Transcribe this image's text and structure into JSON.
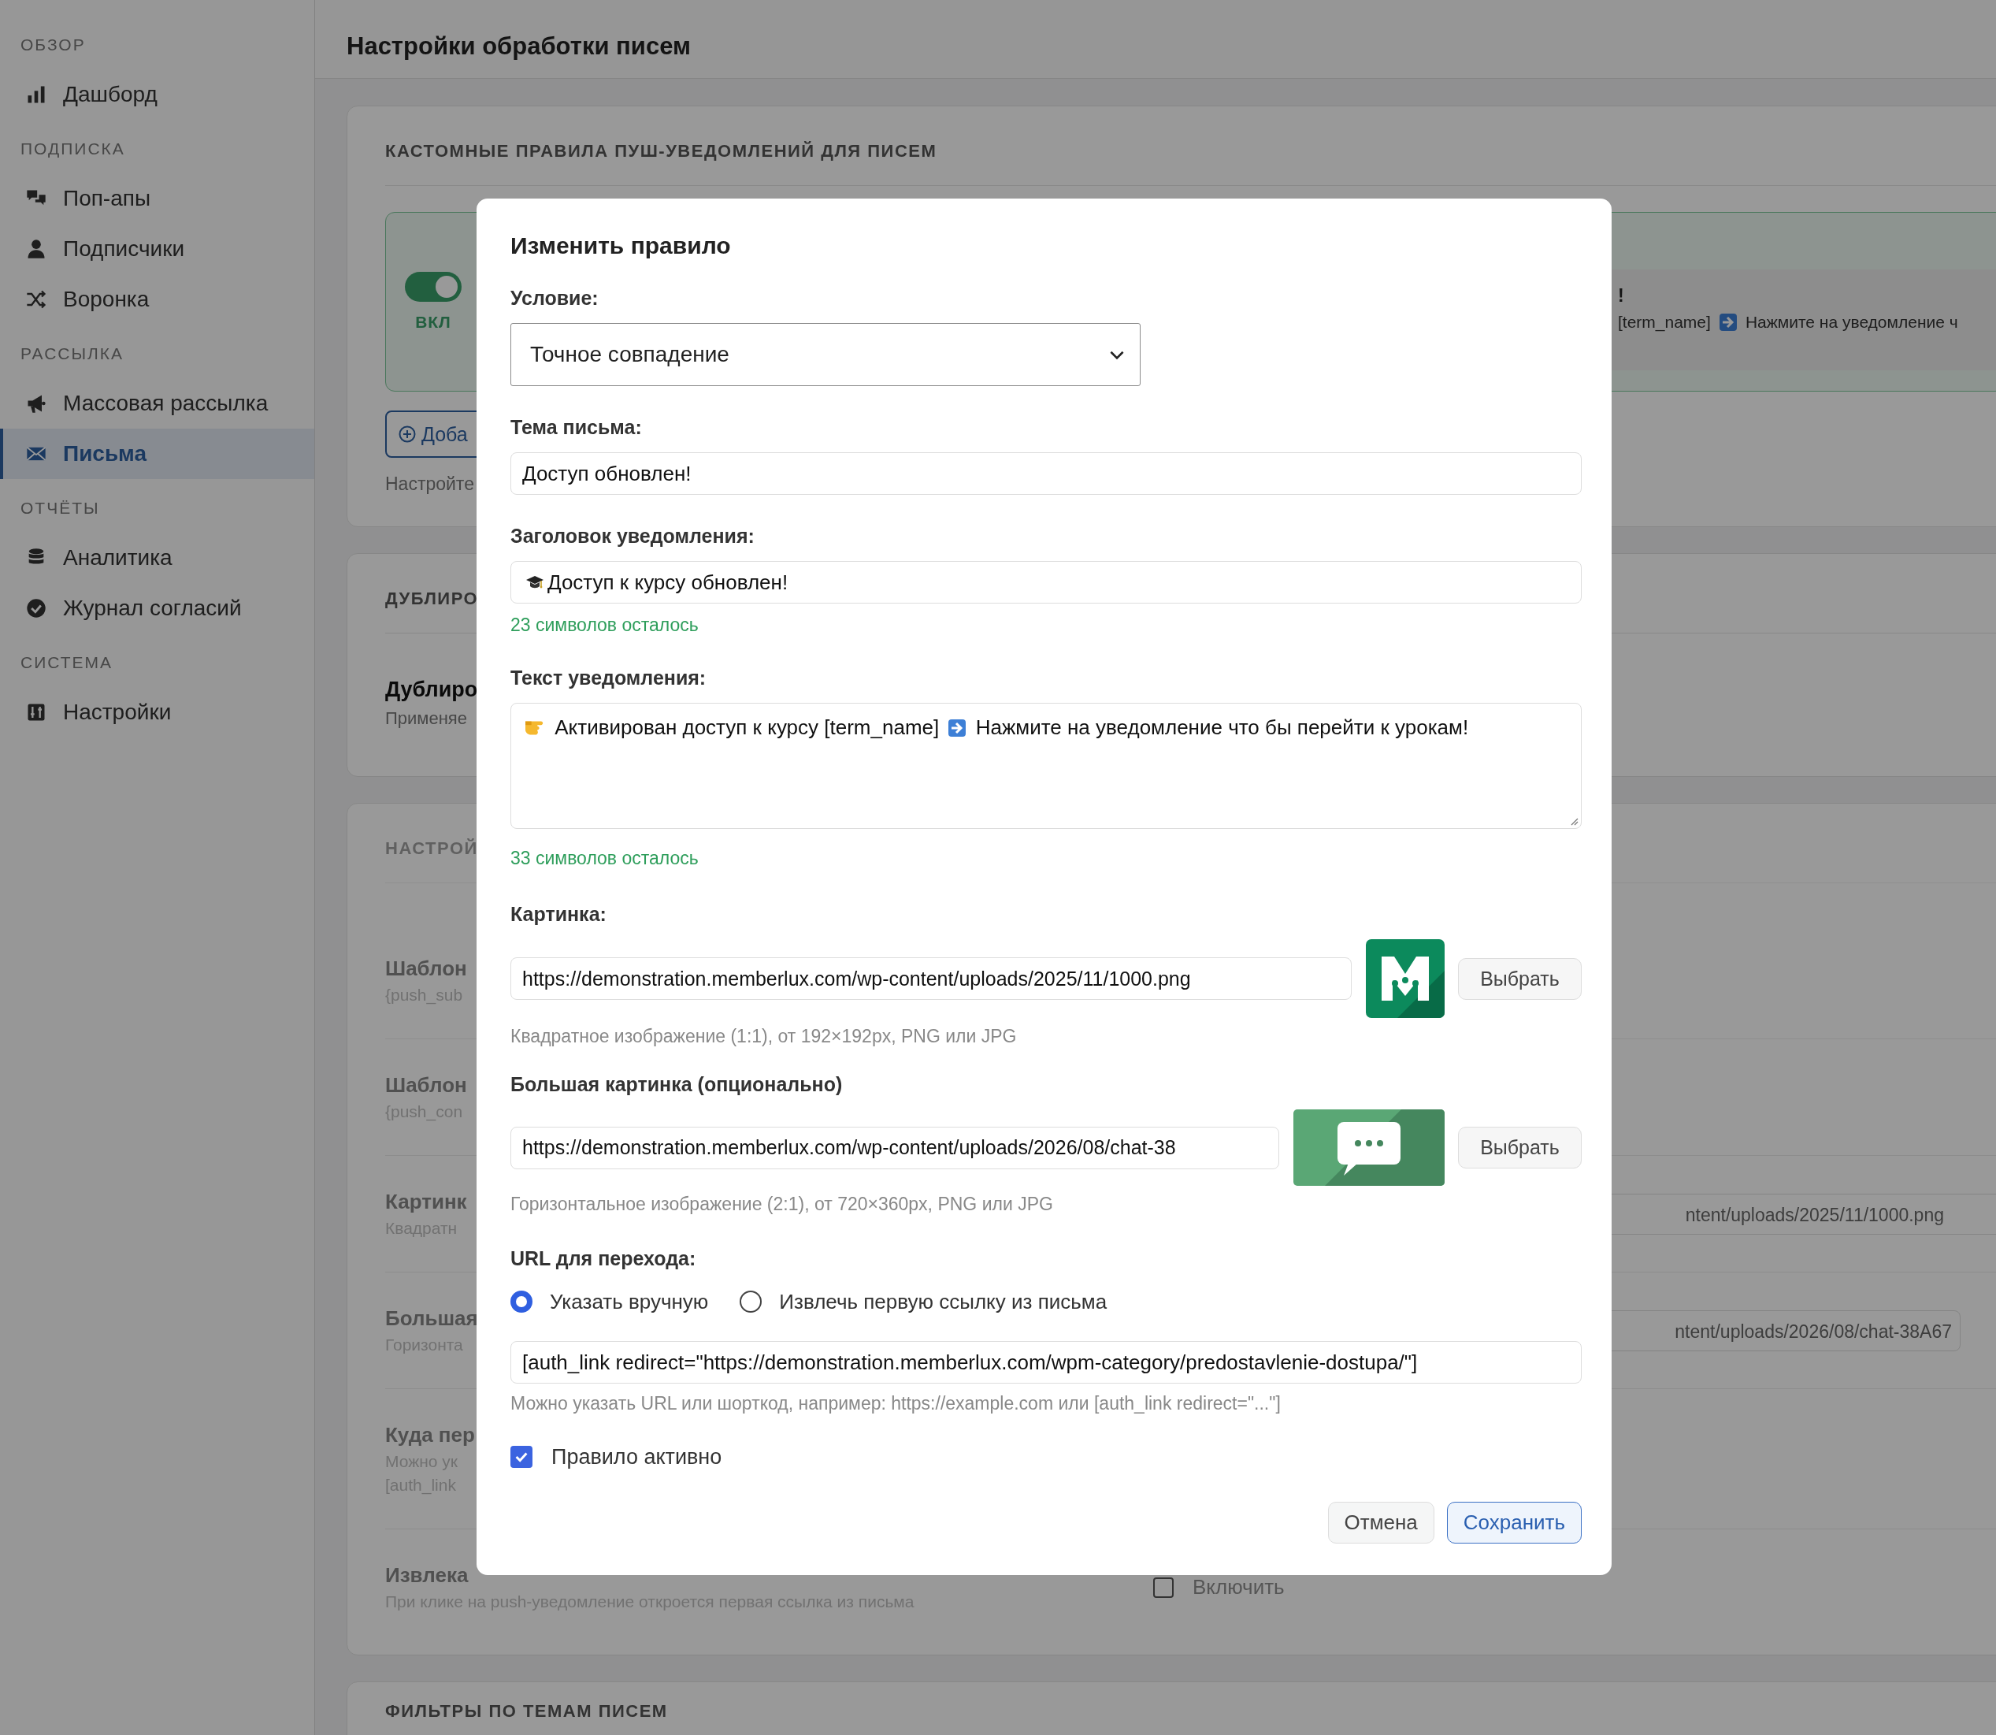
{
  "sidebar": {
    "sections": [
      {
        "title": "ОБЗОР",
        "items": [
          {
            "label": "Дашборд",
            "selected": false
          }
        ]
      },
      {
        "title": "ПОДПИСКА",
        "items": [
          {
            "label": "Поп-апы",
            "selected": false
          },
          {
            "label": "Подписчики",
            "selected": false
          },
          {
            "label": "Воронка",
            "selected": false
          }
        ]
      },
      {
        "title": "РАССЫЛКА",
        "items": [
          {
            "label": "Массовая рассылка",
            "selected": false
          },
          {
            "label": "Письма",
            "selected": true
          }
        ]
      },
      {
        "title": "ОТЧЁТЫ",
        "items": [
          {
            "label": "Аналитика",
            "selected": false
          },
          {
            "label": "Журнал согласий",
            "selected": false
          }
        ]
      },
      {
        "title": "СИСТЕМА",
        "items": [
          {
            "label": "Настройки",
            "selected": false
          }
        ]
      }
    ]
  },
  "page": {
    "title": "Настройки обработки писем"
  },
  "cards": [
    {
      "kind": "rules",
      "heading": "КАСТОМНЫЕ ПРАВИЛА ПУШ-УВЕДОМЛЕНИЙ ДЛЯ ПИСЕМ",
      "rule": {
        "on": true,
        "toggle_label": "ВКЛ",
        "title_tail": "!",
        "text_parts": [
          "[term_name]",
          "Нажмите на уведомление ч"
        ]
      },
      "add_button": "Доба",
      "hint": "Настройте"
    },
    {
      "kind": "duplicate",
      "heading": "ДУБЛИРО",
      "title": "Дублиро",
      "description": "Применяе"
    },
    {
      "kind": "settings",
      "disabled": true,
      "heading": "НАСТРОЙ",
      "rows": [
        {
          "label": "Шаблон",
          "description": [
            "{push_sub"
          ]
        },
        {
          "label": "Шаблон",
          "description": [
            "{push_con"
          ]
        },
        {
          "label": "Картинк",
          "description": [
            "Квадратн"
          ],
          "control": {
            "kind": "field",
            "value": "ntent/uploads/2025/11/1000.png"
          }
        },
        {
          "label": "Большая",
          "description": [
            "Горизонта"
          ],
          "control": {
            "kind": "field",
            "value": "ntent/uploads/2026/08/chat-38A67"
          }
        },
        {
          "label": "Куда пер",
          "description": [
            "Можно ук",
            "[auth_link"
          ]
        },
        {
          "label": "Извлека",
          "description": [
            "При клике на push-уведомление откроется первая ссылка из письма"
          ],
          "control": {
            "kind": "checkbox",
            "label": "Включить",
            "checked": false
          }
        }
      ]
    },
    {
      "kind": "filters",
      "heading": "ФИЛЬТРЫ ПО ТЕМАМ ПИСЕМ"
    }
  ],
  "modal": {
    "title": "Изменить правило",
    "condition": {
      "label": "Условие:",
      "value": "Точное совпадение"
    },
    "subject": {
      "label": "Тема письма:",
      "value": "Доступ обновлен!"
    },
    "push_title": {
      "label": "Заголовок уведомления:",
      "value": "Доступ к курсу обновлен!",
      "counter": "23 символов осталось"
    },
    "push_text": {
      "label": "Текст уведомления:",
      "parts": [
        "Активирован доступ к курсу [term_name]",
        "Нажмите на уведомление что бы перейти к урокам!"
      ],
      "counter": "33 символов осталось"
    },
    "image": {
      "label": "Картинка:",
      "value": "https://demonstration.memberlux.com/wp-content/uploads/2025/11/1000.png",
      "button": "Выбрать",
      "hint": "Квадратное изображение (1:1), от 192×192px, PNG или JPG"
    },
    "large_image": {
      "label": "Большая картинка (опционально)",
      "value": "https://demonstration.memberlux.com/wp-content/uploads/2026/08/chat-38",
      "button": "Выбрать",
      "hint": "Горизонтальное изображение (2:1), от 720×360px, PNG или JPG"
    },
    "url": {
      "label": "URL для перехода:",
      "options": [
        {
          "label": "Указать вручную",
          "selected": true
        },
        {
          "label": "Извлечь первую ссылку из письма",
          "selected": false
        }
      ],
      "value": "[auth_link redirect=\"https://demonstration.memberlux.com/wpm-category/predostavlenie-dostupa/\"]",
      "hint": "Можно указать URL или шорткод, например: https://example.com или [auth_link redirect=\"...\"]"
    },
    "active": {
      "label": "Правило активно",
      "checked": true
    },
    "buttons": [
      {
        "label": "Отмена",
        "kind": "secondary"
      },
      {
        "label": "Сохранить",
        "kind": "primary"
      }
    ]
  }
}
